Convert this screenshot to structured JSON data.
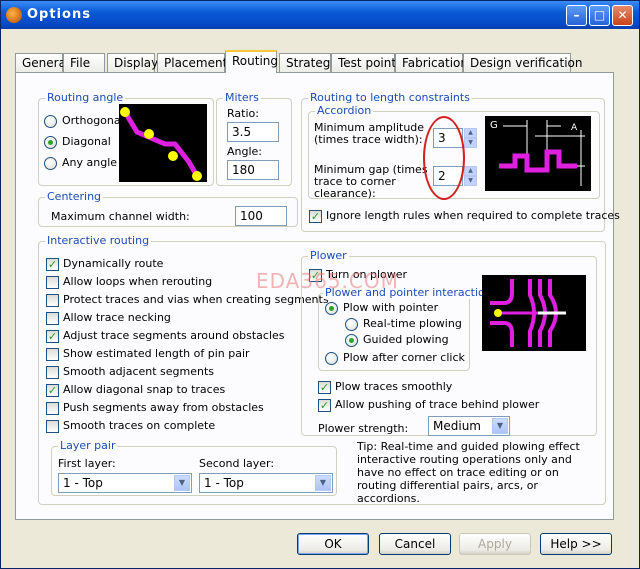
{
  "window": {
    "title": "Options"
  },
  "tabs": [
    "General",
    "File",
    "Display",
    "Placement",
    "Routing",
    "Strategy",
    "Test points",
    "Fabrication",
    "Design verification"
  ],
  "active_tab": "Routing",
  "routing_angle": {
    "title": "Routing angle",
    "options": [
      "Orthogonal",
      "Diagonal",
      "Any angle"
    ],
    "selected": "Diagonal"
  },
  "miters": {
    "title": "Miters",
    "ratio_label": "Ratio:",
    "ratio_value": "3.5",
    "angle_label": "Angle:",
    "angle_value": "180"
  },
  "length": {
    "title": "Routing to length constraints",
    "accordion_title": "Accordion",
    "min_amplitude_label": "Minimum amplitude (times trace width):",
    "min_amplitude_value": "3",
    "min_gap_label": "Minimum gap (times trace to corner clearance):",
    "min_gap_value": "2",
    "diagram_g": "G",
    "diagram_a": "A",
    "ignore_label": "Ignore length rules when required to complete traces",
    "ignore_checked": true
  },
  "centering": {
    "title": "Centering",
    "max_label": "Maximum channel width:",
    "max_value": "100"
  },
  "interactive": {
    "title": "Interactive routing",
    "options": [
      {
        "label": "Dynamically route",
        "checked": true
      },
      {
        "label": "Allow loops when rerouting",
        "checked": false
      },
      {
        "label": "Protect traces and vias when creating segments",
        "checked": false
      },
      {
        "label": "Allow trace necking",
        "checked": false
      },
      {
        "label": "Adjust trace segments around obstacles",
        "checked": true
      },
      {
        "label": "Show estimated length of pin pair",
        "checked": false
      },
      {
        "label": "Smooth adjacent segments",
        "checked": false
      },
      {
        "label": "Allow diagonal snap to traces",
        "checked": true
      },
      {
        "label": "Push segments away from obstacles",
        "checked": false
      },
      {
        "label": "Smooth traces on complete",
        "checked": false
      }
    ]
  },
  "layer_pair": {
    "title": "Layer pair",
    "first_label": "First layer:",
    "first_value": "1 - Top",
    "second_label": "Second layer:",
    "second_value": "1 - Top"
  },
  "plower": {
    "title": "Plower",
    "turn_on_label": "Turn on plower",
    "turn_on_checked": true,
    "interaction_title": "Plower and pointer interaction",
    "plow_with_pointer": "Plow with pointer",
    "realtime": "Real-time plowing",
    "guided": "Guided plowing",
    "after_corner": "Plow after corner click",
    "smoothly_label": "Plow traces smoothly",
    "smoothly_checked": true,
    "pushing_label": "Allow pushing of trace behind plower",
    "pushing_checked": true,
    "strength_label": "Plower strength:",
    "strength_value": "Medium",
    "tip": "Tip: Real-time and guided plowing effect interactive routing operations only and have no effect on trace editing or on routing differential pairs, arcs, or accordions."
  },
  "watermark": "EDA365.COM",
  "buttons": {
    "ok": "OK",
    "cancel": "Cancel",
    "apply": "Apply",
    "help": "Help >>"
  },
  "colors": {
    "title_blue": "#0b5ad6",
    "group_title": "#1b4cb5",
    "trace_magenta": "#e020e0",
    "pad_yellow": "#ffff00"
  }
}
